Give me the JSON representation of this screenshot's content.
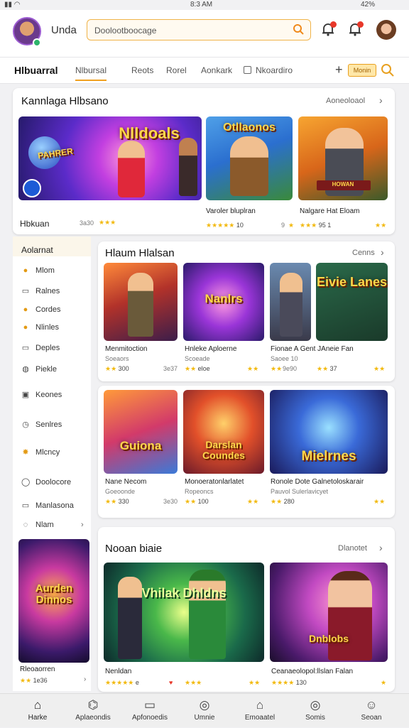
{
  "status": {
    "time": "8:3 AM",
    "battery": "42%"
  },
  "header": {
    "username": "Unda",
    "search_placeholder": "Doolootboocage"
  },
  "nav": {
    "items": [
      "Hlbuarral",
      "Nlbursal",
      "Reots",
      "Rorel",
      "Aonkark",
      "Nkoardiro"
    ],
    "active": "Nlbursal"
  },
  "nav_action": {
    "label": "Monin"
  },
  "section1": {
    "title": "Kannlaga Hlbsano",
    "more": "Aoneoloaol",
    "side_label": "Hbkuan",
    "side_count": "3a30",
    "items": [
      {
        "title": "Varoler bluplran",
        "rating": "10",
        "count": "9"
      },
      {
        "title": "Nalgare Hat Eloam",
        "rating": "95 1",
        "count": ""
      }
    ],
    "banner": "Nlldoals",
    "banner_sub": "PAHRER",
    "tile2": "Otllaonos",
    "tile3": "HOWAN"
  },
  "sidebar": {
    "title": "Aolarnat",
    "items": [
      "Mlom",
      "Ralnes",
      "Cordes",
      "Nlinles",
      "Deples",
      "Piekle",
      "Keones",
      "Senlres",
      "Mlcncy",
      "Doolocore",
      "Manlasona",
      "Nlam"
    ],
    "card_label": "Rleoaorren",
    "card_rating": "1e36",
    "card_text": "Aurden Dinnos"
  },
  "section2": {
    "title": "Hlaum Hlalsan",
    "more": "Cenns",
    "row1": [
      {
        "title": "Menmitoction",
        "sub": "Soeaors",
        "rating": "300",
        "count": "3e37",
        "art": ""
      },
      {
        "title": "Hnleke Aploerne",
        "sub": "Scoeade",
        "rating": "eloe",
        "count": "",
        "art": "Nanlrs"
      },
      {
        "title": "Fionae A Gent JAneie Fan",
        "sub": "Saoee 10",
        "rating": "",
        "count": "9e90",
        "art": ""
      },
      {
        "title": "",
        "sub": "",
        "rating": "37",
        "count": "",
        "art": "Eivie Lanes"
      }
    ],
    "row2": [
      {
        "title": "Nane Necom",
        "sub": "Goeoonde",
        "rating": "330",
        "count": "3e30",
        "art": "Guiona"
      },
      {
        "title": "Monoeratonlarlatet",
        "sub": "Ropeoncs",
        "rating": "100",
        "count": "",
        "art": "Darslan Coundes"
      },
      {
        "title": "Ronole Dote Galnetoloskarair",
        "sub": "Pauvol Sulerlavicyet",
        "rating": "280",
        "count": "",
        "art": "Mielrnes"
      }
    ]
  },
  "section3": {
    "title": "Nooan biaie",
    "more": "Dlanotet",
    "items": [
      {
        "title": "Nenldan",
        "sub": "",
        "rating": "e",
        "count": "",
        "art": "Vhilak Dhldns"
      },
      {
        "title": "Ceanaeolopol:llslan Falan",
        "sub": "",
        "rating": "130",
        "count": "",
        "art": "Dnblobs"
      }
    ]
  },
  "tabbar": {
    "items": [
      "Harke",
      "Aplaeondis",
      "Apfonoedis",
      "Umnie",
      "Emoaatel",
      "Somis",
      "Seoan"
    ],
    "active": "Harke"
  }
}
